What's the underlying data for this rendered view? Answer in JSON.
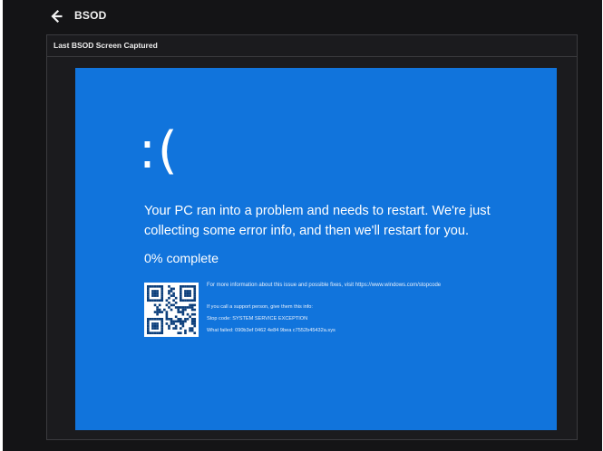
{
  "header": {
    "back_icon": "arrow-left-icon",
    "title": "BSOD"
  },
  "panel": {
    "title": "Last BSOD Screen Captured"
  },
  "bsod": {
    "background_color": "#1174dc",
    "face": ":(",
    "message": "Your PC ran into a problem and needs to restart. We're just collecting some error info, and then we'll restart for you.",
    "progress_text": "0% complete",
    "progress_percent": 0,
    "qr_icon": "qr-code-icon",
    "more_info": "For more information about this issue and possible fixes, visit https://www.windows.com/stopcode",
    "support_text": "If you call a support person, give them this info:",
    "stop_code": "Stop code: SYSTEM SERVICE EXCEPTION",
    "what_failed": "What failed: 090b3ef 0462 4e84 9bea c7552b45432a.sys"
  }
}
